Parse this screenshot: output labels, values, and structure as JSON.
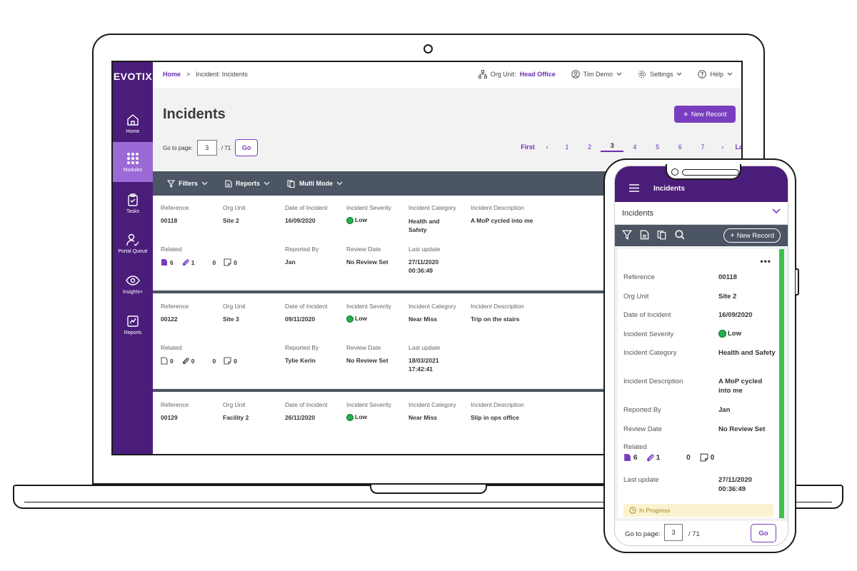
{
  "app": {
    "logo": "EVOTIX"
  },
  "sidebar": {
    "items": [
      {
        "label": "Home",
        "icon": "home-icon"
      },
      {
        "label": "Modules",
        "icon": "grid-icon",
        "active": true
      },
      {
        "label": "Tasks",
        "icon": "clipboard-icon"
      },
      {
        "label": "Portal Queue",
        "icon": "person-check-icon"
      },
      {
        "label": "Insights+",
        "icon": "eye-icon"
      },
      {
        "label": "Reports",
        "icon": "chart-icon"
      }
    ]
  },
  "breadcrumb": {
    "home": "Home",
    "sep": ">",
    "current": "Incident: Incidents"
  },
  "topbar": {
    "org_label": "Org Unit:",
    "org_value": "Head Office",
    "user": "Tim Demo",
    "settings": "Settings",
    "help": "Help"
  },
  "page": {
    "title": "Incidents",
    "new_record": "New Record",
    "goto_label": "Go to page:",
    "goto_value": "3",
    "goto_total": "/ 71",
    "go": "Go"
  },
  "pager": {
    "first": "First",
    "last": "Last",
    "pages": [
      "1",
      "2",
      "3",
      "4",
      "5",
      "6",
      "7"
    ],
    "current": "3"
  },
  "toolbar": {
    "filters": "Filters",
    "reports": "Reports",
    "multi": "Multi Mode"
  },
  "labels": {
    "reference": "Reference",
    "org_unit": "Org Unit",
    "date": "Date of Incident",
    "severity": "Incident Severity",
    "category": "Incident Category",
    "description": "Incident Description",
    "related": "Related",
    "reported_by": "Reported By",
    "review_date": "Review Date",
    "last_update": "Last update"
  },
  "records": [
    {
      "reference": "00118",
      "org_unit": "Site 2",
      "date": "16/09/2020",
      "severity": "Low",
      "category": "Health and Safety",
      "description": "A MoP cycled into me",
      "related_a": "6",
      "related_b": "1",
      "related_c": "0",
      "related_d": "0",
      "reported_by": "Jan",
      "review_date": "No Review Set",
      "last_update_d": "27/11/2020",
      "last_update_t": "00:36:49"
    },
    {
      "reference": "00122",
      "org_unit": "Site 3",
      "date": "09/11/2020",
      "severity": "Low",
      "category": "Near Miss",
      "description": "Trip on the stairs",
      "related_a": "0",
      "related_b": "0",
      "related_c": "0",
      "related_d": "0",
      "reported_by": "Tylie Kerin",
      "review_date": "No Review Set",
      "last_update_d": "18/03/2021",
      "last_update_t": "17:42:41"
    },
    {
      "reference": "00129",
      "org_unit": "Facility 2",
      "date": "26/11/2020",
      "severity": "Low",
      "category": "Near Miss",
      "description": "Slip in ops office"
    }
  ],
  "mobile": {
    "header": "Incidents",
    "select": "Incidents",
    "new_record": "New Record",
    "more": "•••",
    "rows": [
      {
        "label": "Reference",
        "value": "00118"
      },
      {
        "label": "Org Unit",
        "value": "Site 2"
      },
      {
        "label": "Date of Incident",
        "value": "16/09/2020"
      },
      {
        "label": "Incident Severity",
        "value": "Low"
      },
      {
        "label": "Incident Category",
        "value": "Health and Safety"
      },
      {
        "label": "Incident Description",
        "value": "A MoP cycled into me"
      },
      {
        "label": "Reported By",
        "value": "Jan"
      },
      {
        "label": "Review Date",
        "value": "No Review Set"
      }
    ],
    "related_label": "Related",
    "related_a": "6",
    "related_b": "1",
    "related_c": "0",
    "related_d": "0",
    "last_update_label": "Last update",
    "last_update_d": "27/11/2020",
    "last_update_t": "00:36:49",
    "status": "In Progress",
    "goto_label": "Go to page:",
    "goto_value": "3",
    "goto_total": "/ 71",
    "go": "Go"
  },
  "colors": {
    "brand": "#4a1d7a",
    "accent": "#7a3dbf",
    "toolbar": "#4b5563",
    "low": "#22b14c"
  }
}
